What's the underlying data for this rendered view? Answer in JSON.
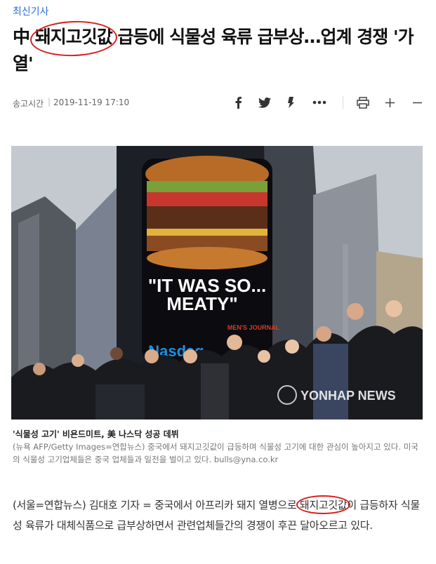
{
  "category": "최신기사",
  "headline": {
    "prefix": "中 ",
    "circled": "돼지고깃값",
    "suffix": " 급등에 식물성 육류 급부상…업계 경쟁 '가열'"
  },
  "meta": {
    "send_label": "송고시간",
    "separator": "|",
    "send_time": "2019-11-19 17:10"
  },
  "toolbar": {
    "icons": [
      "facebook-icon",
      "twitter-icon",
      "story-icon",
      "more-icon",
      "print-icon",
      "font-increase-icon",
      "font-decrease-icon"
    ]
  },
  "photo": {
    "billboard_text_line1": "\"IT WAS SO...",
    "billboard_text_line2": "MEATY\"",
    "billboard_brand": "Nasdaq",
    "billboard_tag": "MEN'S JOURNAL",
    "watermark": "YONHAP NEWS"
  },
  "caption": {
    "title": "'식물성 고기' 비욘드미트, 美 나스닥 성공 데뷔",
    "body": "(뉴욕 AFP/Getty Images=연합뉴스) 중국에서 돼지고깃값이 급등하며 식물성 고기에 대한 관심이 높아지고 있다. 미국의 식물성 고기업체들은 중국 업체들과 일전을 벌이고 있다. bulls@yna.co.kr"
  },
  "body": {
    "before": "(서울=연합뉴스) 김대호 기자 = 중국에서 아프리카 돼지 열병으로 ",
    "circled": "돼지고깃값",
    "after": "이 급등하자 식물성 육류가 대체식품으로 급부상하면서 관련업체들간의 경쟁이 후끈 달아오르고 있다."
  },
  "colors": {
    "category": "#2b6fd6",
    "circle": "#d81f1f"
  }
}
